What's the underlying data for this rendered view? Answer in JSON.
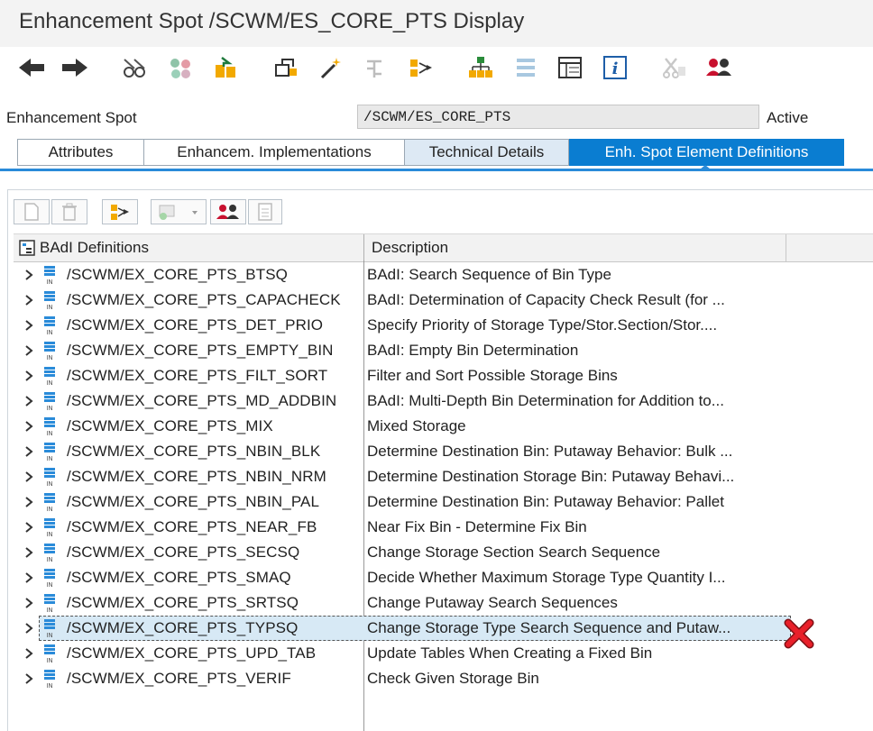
{
  "window": {
    "title": "Enhancement Spot /SCWM/ES_CORE_PTS Display"
  },
  "toolbar": {
    "icons": [
      "back-arrow-icon",
      "forward-arrow-icon",
      "glasses-icon",
      "object-list-icon",
      "transport-icon",
      "activate-icon",
      "magic-wand-icon",
      "where-used-icon",
      "hierarchy-icon",
      "org-chart-icon",
      "compare-icon",
      "table-icon",
      "info-icon",
      "scissors-disabled-icon",
      "users-icon"
    ]
  },
  "fields": {
    "spot_label": "Enhancement Spot",
    "spot_value": "/SCWM/ES_CORE_PTS",
    "status": "Active"
  },
  "tabs": [
    {
      "label": "Attributes",
      "state": "normal"
    },
    {
      "label": "Enhancem. Implementations",
      "state": "normal"
    },
    {
      "label": "Technical Details",
      "state": "blue"
    },
    {
      "label": "Enh. Spot Element Definitions",
      "state": "active"
    }
  ],
  "grid": {
    "col1": "BAdI Definitions",
    "col2": "Description",
    "rows": [
      {
        "name": "/SCWM/EX_CORE_PTS_BTSQ",
        "desc": "BAdI: Search Sequence of Bin Type"
      },
      {
        "name": "/SCWM/EX_CORE_PTS_CAPACHECK",
        "desc": "BAdI: Determination of Capacity Check Result (for ..."
      },
      {
        "name": "/SCWM/EX_CORE_PTS_DET_PRIO",
        "desc": "Specify Priority of Storage Type/Stor.Section/Stor...."
      },
      {
        "name": "/SCWM/EX_CORE_PTS_EMPTY_BIN",
        "desc": "BAdI: Empty Bin Determination"
      },
      {
        "name": "/SCWM/EX_CORE_PTS_FILT_SORT",
        "desc": "Filter and Sort Possible Storage Bins"
      },
      {
        "name": "/SCWM/EX_CORE_PTS_MD_ADDBIN",
        "desc": "BAdI: Multi-Depth Bin Determination for Addition to..."
      },
      {
        "name": "/SCWM/EX_CORE_PTS_MIX",
        "desc": "Mixed Storage"
      },
      {
        "name": "/SCWM/EX_CORE_PTS_NBIN_BLK",
        "desc": "Determine Destination Bin: Putaway Behavior: Bulk ..."
      },
      {
        "name": "/SCWM/EX_CORE_PTS_NBIN_NRM",
        "desc": "Determine Destination Storage Bin: Putaway Behavi..."
      },
      {
        "name": "/SCWM/EX_CORE_PTS_NBIN_PAL",
        "desc": "Determine Destination Bin: Putaway Behavior: Pallet"
      },
      {
        "name": "/SCWM/EX_CORE_PTS_NEAR_FB",
        "desc": "Near Fix Bin - Determine Fix Bin"
      },
      {
        "name": "/SCWM/EX_CORE_PTS_SECSQ",
        "desc": "Change Storage Section Search Sequence"
      },
      {
        "name": "/SCWM/EX_CORE_PTS_SMAQ",
        "desc": "Decide Whether Maximum Storage Type Quantity I..."
      },
      {
        "name": "/SCWM/EX_CORE_PTS_SRTSQ",
        "desc": "Change Putaway Search Sequences"
      },
      {
        "name": "/SCWM/EX_CORE_PTS_TYPSQ",
        "desc": "Change Storage Type Search Sequence and Putaw...",
        "selected": true
      },
      {
        "name": "/SCWM/EX_CORE_PTS_UPD_TAB",
        "desc": "Update Tables When Creating a Fixed Bin"
      },
      {
        "name": "/SCWM/EX_CORE_PTS_VERIF",
        "desc": "Check Given Storage Bin"
      }
    ]
  },
  "colors": {
    "accent": "#0a7dd1",
    "selection": "#d7e9f5",
    "marker": "#e8202a"
  }
}
